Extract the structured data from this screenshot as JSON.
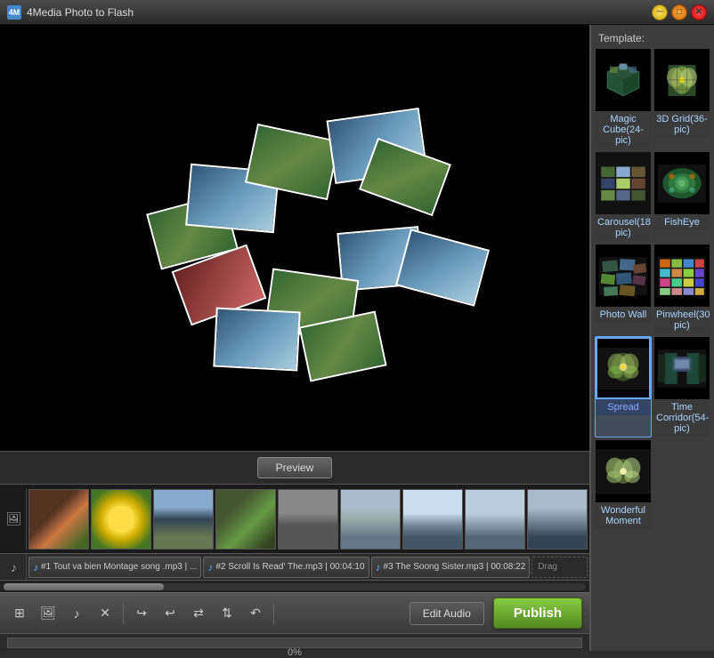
{
  "app": {
    "title": "4Media Photo to Flash",
    "icon": "4M"
  },
  "window_controls": {
    "minimize_label": "─",
    "maximize_label": "□",
    "close_label": "✕"
  },
  "preview": {
    "button_label": "Preview"
  },
  "template_section": {
    "header": "Template:",
    "items": [
      {
        "id": "magic-cube",
        "label": "Magic Cube(24-pic)",
        "selected": false
      },
      {
        "id": "3d-grid",
        "label": "3D Grid(36-pic)",
        "selected": false
      },
      {
        "id": "carousel",
        "label": "Carousel(18-pic)",
        "selected": false
      },
      {
        "id": "fisheye",
        "label": "FishEye",
        "selected": false
      },
      {
        "id": "photo-wall",
        "label": "Photo Wall",
        "selected": false
      },
      {
        "id": "pinwheel",
        "label": "Pinwheel(30-pic)",
        "selected": false
      },
      {
        "id": "spread",
        "label": "Spread",
        "selected": true
      },
      {
        "id": "time-corridor",
        "label": "Time Corridor(54-pic)",
        "selected": false
      },
      {
        "id": "wonderful-moment",
        "label": "Wonderful Moment",
        "selected": false
      }
    ]
  },
  "audio_tracks": [
    {
      "id": 1,
      "icon": "♪",
      "text": "#1 Tout va bien Montage song .mp3 | ..."
    },
    {
      "id": 2,
      "icon": "♪",
      "text": "#2 Scroll Is Read' The.mp3 | 00:04:10"
    },
    {
      "id": 3,
      "icon": "♪",
      "text": "#3 The Soong Sister.mp3 | 00:08:22"
    },
    {
      "id": "drag",
      "text": "Drag"
    }
  ],
  "toolbar": {
    "edit_audio_label": "Edit Audio",
    "publish_label": "Publish",
    "tools": [
      {
        "id": "fit",
        "icon": "⊞",
        "title": "Fit"
      },
      {
        "id": "image",
        "icon": "🖼",
        "title": "Image"
      },
      {
        "id": "audio",
        "icon": "♪",
        "title": "Audio"
      },
      {
        "id": "delete",
        "icon": "✕",
        "title": "Delete"
      },
      {
        "id": "sep1",
        "type": "sep"
      },
      {
        "id": "undo",
        "icon": "↩",
        "title": "Undo"
      },
      {
        "id": "redo",
        "icon": "↪",
        "title": "Redo"
      },
      {
        "id": "loop",
        "icon": "⟳",
        "title": "Loop"
      },
      {
        "id": "shuffle",
        "icon": "⇅",
        "title": "Shuffle"
      },
      {
        "id": "back",
        "icon": "↶",
        "title": "Back"
      },
      {
        "id": "sep2",
        "type": "sep"
      }
    ]
  },
  "progress": {
    "value": "0",
    "label": "0%"
  },
  "strip_photos": [
    {
      "id": 1,
      "class": "sph1"
    },
    {
      "id": 2,
      "class": "sph2"
    },
    {
      "id": 3,
      "class": "sph3"
    },
    {
      "id": 4,
      "class": "sph4"
    },
    {
      "id": 5,
      "class": "sph5"
    },
    {
      "id": 6,
      "class": "sph6"
    },
    {
      "id": 7,
      "class": "sph7"
    },
    {
      "id": 8,
      "class": "sph8"
    },
    {
      "id": 9,
      "class": "sph9"
    }
  ]
}
